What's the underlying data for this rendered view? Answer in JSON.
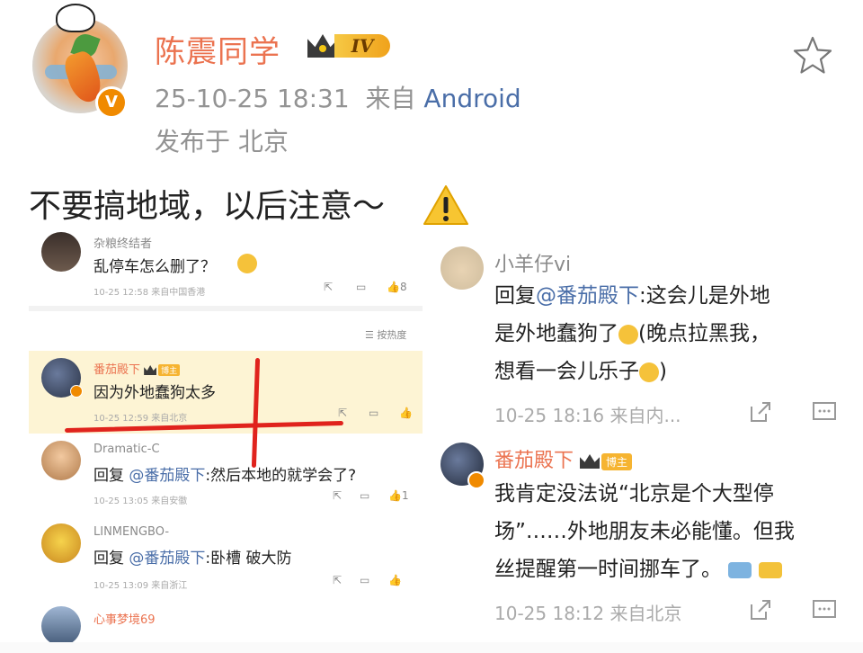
{
  "post": {
    "username": "陈震同学",
    "level": "IV",
    "timestamp": "25-10-25 18:31",
    "from_label": "来自",
    "source": "Android",
    "location": "发布于 北京",
    "text": "不要搞地域，以后注意～",
    "icons": [
      "star-icon",
      "warning-icon",
      "verified-v-icon",
      "crown-icon"
    ],
    "accent_color": "#eb7350",
    "link_color": "#4a6ea8"
  },
  "left_screenshot": {
    "sort_label": "按热度",
    "comments": [
      {
        "name": "杂粮终结者",
        "text": "乱停车怎么删了？",
        "meta": "10-25 12:58  来自中国香港",
        "likes": "8"
      },
      {
        "name": "番茄殿下",
        "tag": "博主",
        "text": "因为外地蠢狗太多",
        "meta": "10-25 12:59  来自北京",
        "likes": ""
      },
      {
        "name": "Dramatic-C",
        "text": "回复 @番茄殿下:然后本地的就学会了?",
        "reply_prefix": "回复 ",
        "mention": "@番茄殿下",
        "rest": ":然后本地的就学会了?",
        "meta": "10-25 13:05  来自安徽",
        "likes": "1"
      },
      {
        "name": "LINMENGBO-",
        "text": "回复 @番茄殿下:卧槽 破大防",
        "reply_prefix": "回复 ",
        "mention": "@番茄殿下",
        "rest": ":卧槽 破大防",
        "meta": "10-25 13:09  来自浙江",
        "likes": ""
      },
      {
        "name": "心事梦境69",
        "text": "",
        "meta": "",
        "likes": ""
      }
    ]
  },
  "right_screenshot": {
    "comments": [
      {
        "name": "小羊仔vi",
        "lines": [
          "回复@番茄殿下:这会儿是外地",
          "是外地蠢狗了",
          "(晚点拉黑我，",
          "想看一会儿乐子",
          ")"
        ],
        "reply_prefix": "回复",
        "mention": "@番茄殿下",
        "meta": "10-25 18:16  来自内..."
      },
      {
        "name": "番茄殿下",
        "tag": "博主",
        "lines": [
          "我肯定没法说“北京是个大型停",
          "场”……外地朋友未必能懂。但我",
          "丝提醒第一时间挪车了。"
        ],
        "meta": "10-25 18:12  来自北京"
      }
    ]
  }
}
